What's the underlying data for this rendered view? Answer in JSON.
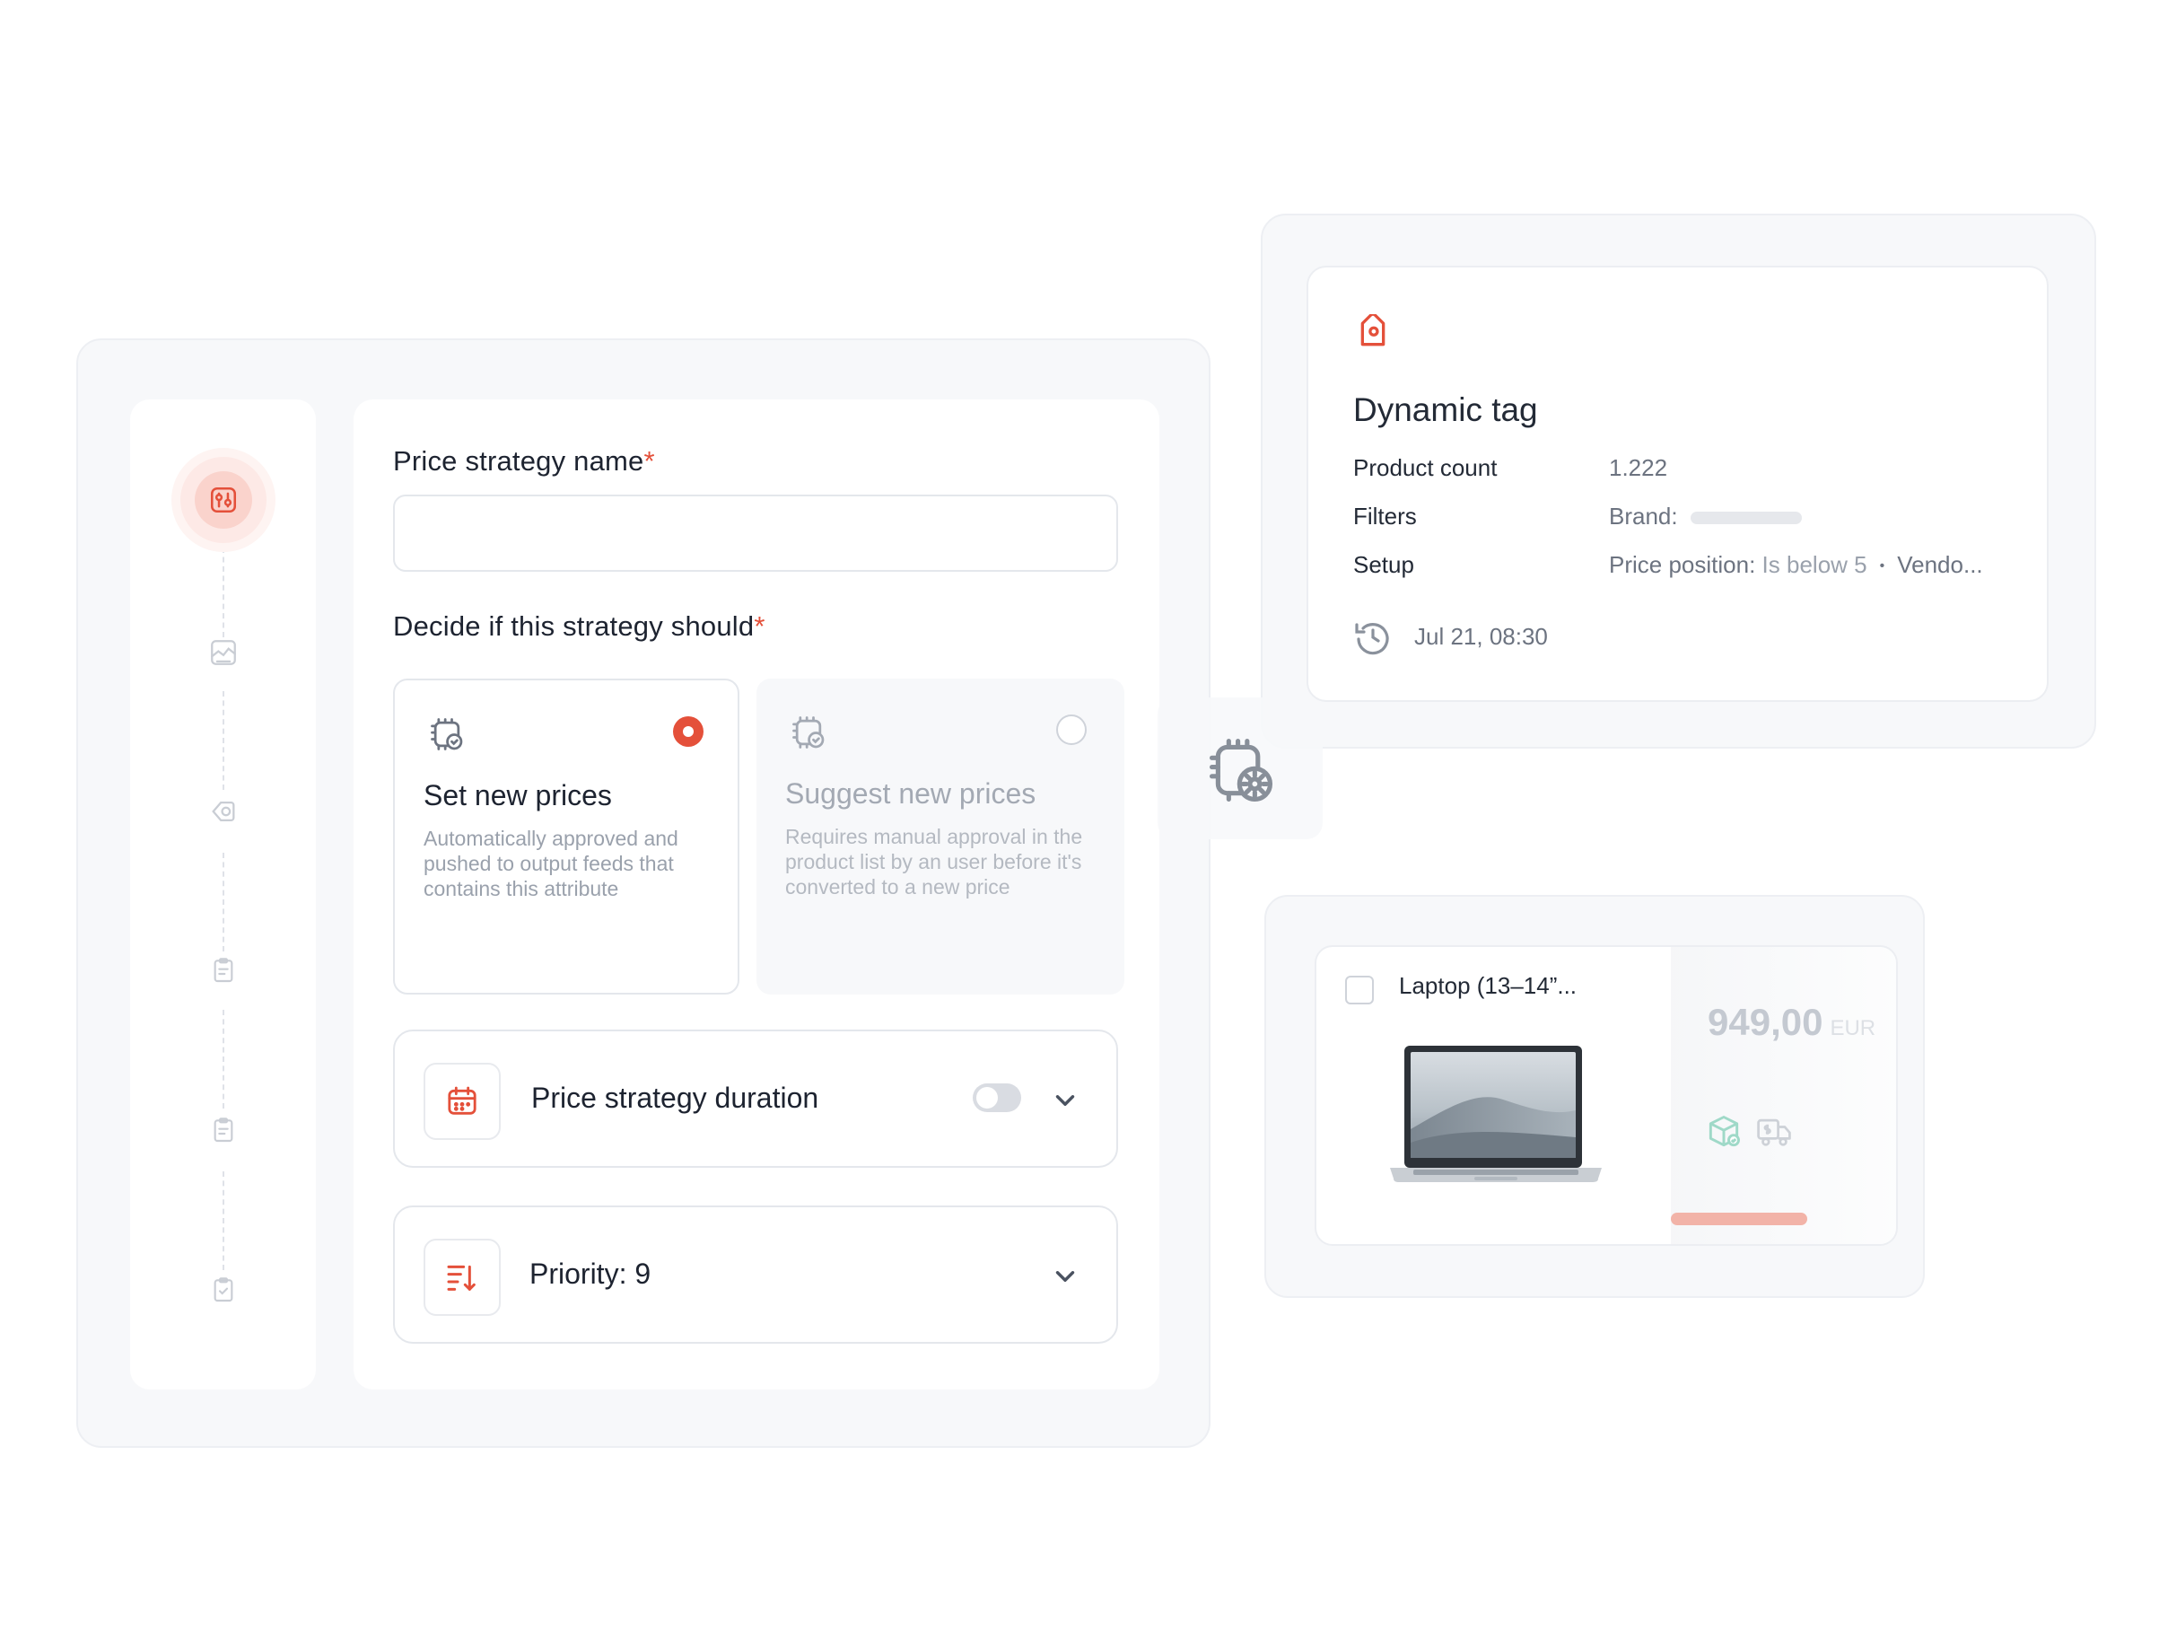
{
  "form": {
    "name_label": "Price strategy name",
    "required_mark": "*",
    "name_value": "",
    "decide_label": "Decide if this strategy should",
    "options": [
      {
        "title": "Set new prices",
        "desc": "Automatically approved and pushed to output feeds that contains this attribute",
        "selected": true
      },
      {
        "title": "Suggest new prices",
        "desc": "Requires manual approval in the product list by an user before it's converted to a new price",
        "selected": false
      }
    ],
    "duration_label": "Price strategy duration",
    "duration_enabled": false,
    "priority_label": "Priority: 9"
  },
  "stepper": {
    "icons": [
      "settings-sliders-icon",
      "image-chart-icon",
      "tag-gear-icon",
      "clipboard-icon",
      "clipboard-icon",
      "clipboard-check-icon"
    ],
    "active_step": 1
  },
  "tag": {
    "title": "Dynamic tag",
    "product_count_label": "Product count",
    "product_count_value": "1.222",
    "filters_label": "Filters",
    "filters_value": "Brand:",
    "setup_label": "Setup",
    "setup_key": "Price position:",
    "setup_value": "Is below 5",
    "setup_sep": "•",
    "setup_more": "Vendo...",
    "timestamp": "Jul 21, 08:30"
  },
  "product": {
    "name": "Laptop (13–14”...",
    "price": "949,00",
    "currency": "EUR"
  },
  "colors": {
    "accent": "#e4503a",
    "panel": "#f7f8fa",
    "border": "#e4e7ec"
  }
}
